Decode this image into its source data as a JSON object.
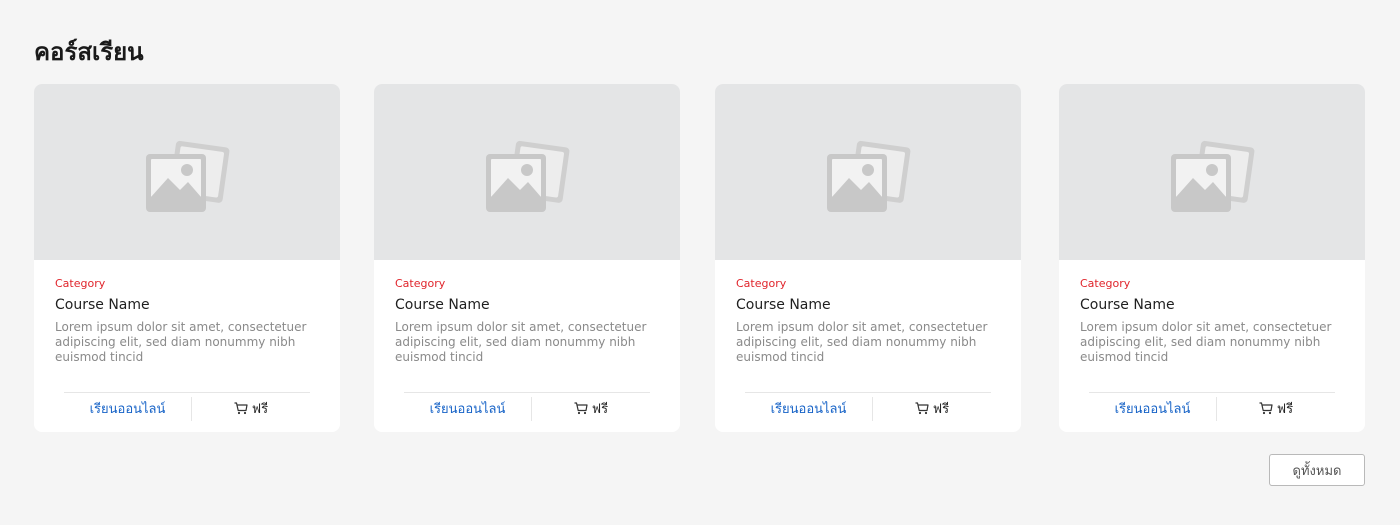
{
  "section": {
    "title": "คอร์สเรียน"
  },
  "cards": [
    {
      "image_icon": "image-placeholder-icon",
      "category": "Category",
      "name": "Course Name",
      "description": "Lorem ipsum dolor sit amet, consectetuer adipiscing elit, sed diam nonummy nibh euismod tincid",
      "learn_label": "เรียนออนไลน์",
      "cart_icon": "cart-icon",
      "price_label": "ฟรี"
    },
    {
      "image_icon": "image-placeholder-icon",
      "category": "Category",
      "name": "Course Name",
      "description": "Lorem ipsum dolor sit amet, consectetuer adipiscing elit, sed diam nonummy nibh euismod tincid",
      "learn_label": "เรียนออนไลน์",
      "cart_icon": "cart-icon",
      "price_label": "ฟรี"
    },
    {
      "image_icon": "image-placeholder-icon",
      "category": "Category",
      "name": "Course Name",
      "description": "Lorem ipsum dolor sit amet, consectetuer adipiscing elit, sed diam nonummy nibh euismod tincid",
      "learn_label": "เรียนออนไลน์",
      "cart_icon": "cart-icon",
      "price_label": "ฟรี"
    },
    {
      "image_icon": "image-placeholder-icon",
      "category": "Category",
      "name": "Course Name",
      "description": "Lorem ipsum dolor sit amet, consectetuer adipiscing elit, sed diam nonummy nibh euismod tincid",
      "learn_label": "เรียนออนไลน์",
      "cart_icon": "cart-icon",
      "price_label": "ฟรี"
    }
  ],
  "footer": {
    "see_all_label": "ดูทั้งหมด"
  },
  "colors": {
    "background": "#f5f5f5",
    "thumbnail": "#e4e5e6",
    "category": "#e0242b",
    "link": "#1763c7"
  }
}
